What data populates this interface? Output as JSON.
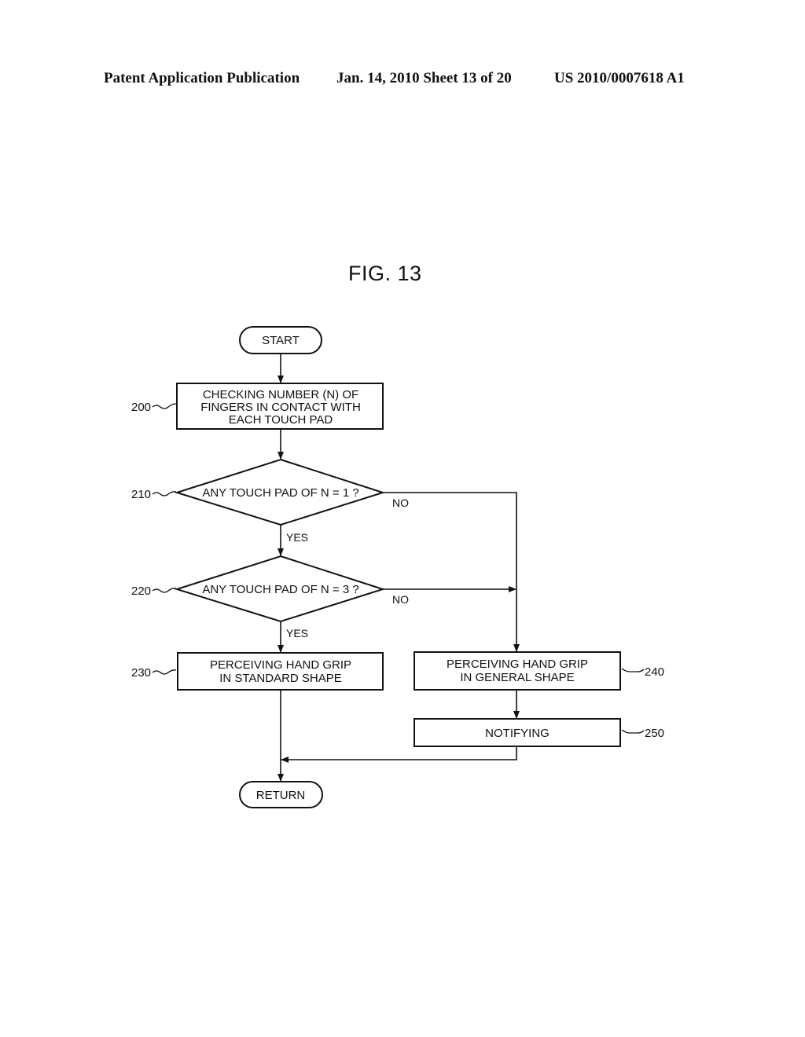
{
  "header": {
    "publication": "Patent Application Publication",
    "date_sheet": "Jan. 14, 2010  Sheet 13 of 20",
    "patent_number": "US 2010/0007618 A1"
  },
  "figure": {
    "title": "FIG. 13"
  },
  "flowchart": {
    "nodes": {
      "start": {
        "type": "terminal",
        "lines": [
          "START"
        ]
      },
      "step_200": {
        "type": "process",
        "ref": "200",
        "lines": [
          "CHECKING NUMBER (N) OF",
          "FINGERS IN CONTACT WITH",
          "EACH TOUCH PAD"
        ]
      },
      "step_210": {
        "type": "decision",
        "ref": "210",
        "lines": [
          "ANY TOUCH PAD OF N = 1 ?"
        ]
      },
      "step_220": {
        "type": "decision",
        "ref": "220",
        "lines": [
          "ANY TOUCH PAD OF N = 3 ?"
        ]
      },
      "step_230": {
        "type": "process",
        "ref": "230",
        "lines": [
          "PERCEIVING HAND GRIP",
          "IN STANDARD SHAPE"
        ]
      },
      "step_240": {
        "type": "process",
        "ref": "240",
        "lines": [
          "PERCEIVING HAND GRIP",
          "IN GENERAL SHAPE"
        ]
      },
      "step_250": {
        "type": "process",
        "ref": "250",
        "lines": [
          "NOTIFYING"
        ]
      },
      "return": {
        "type": "terminal",
        "lines": [
          "RETURN"
        ]
      }
    },
    "edges": [
      {
        "from": "start",
        "to": "step_200",
        "label": ""
      },
      {
        "from": "step_200",
        "to": "step_210",
        "label": ""
      },
      {
        "from": "step_210",
        "to": "step_220",
        "label": "YES"
      },
      {
        "from": "step_210",
        "to": "step_240",
        "label": "NO"
      },
      {
        "from": "step_220",
        "to": "step_230",
        "label": "YES"
      },
      {
        "from": "step_220",
        "to": "step_240",
        "label": "NO"
      },
      {
        "from": "step_240",
        "to": "step_250",
        "label": ""
      },
      {
        "from": "step_230",
        "to": "return",
        "label": ""
      },
      {
        "from": "step_250",
        "to": "return",
        "label": ""
      }
    ]
  }
}
